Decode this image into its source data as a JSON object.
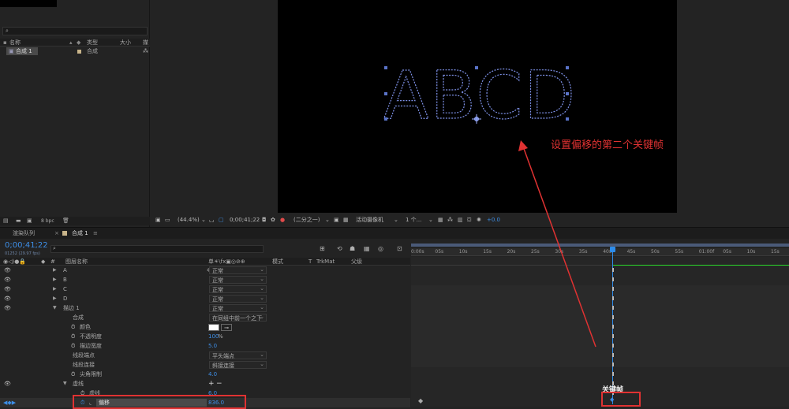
{
  "project": {
    "search_icon": "search-icon",
    "col_name": "名称",
    "col_type": "类型",
    "col_size": "大小",
    "col_extra": "媒",
    "item_name": "合成 1",
    "item_type": "合成",
    "bpc": "8 bpc"
  },
  "viewer": {
    "letters": "ABCD",
    "zoom": "(44.4%)",
    "timecode": "0;00;41;22",
    "resolution": "(二分之一)",
    "camera": "活动摄像机",
    "views": "1 个...",
    "exposure": "+0.0",
    "annotation": "设置偏移的第二个关键帧"
  },
  "timeline": {
    "tab_render": "渲染队列",
    "tab_comp": "合成 1",
    "timecode": "0;00;41;22",
    "frame_info": "01252 (29.97 fps)",
    "col_layer": "图层名称",
    "col_switches": "单☀\\fx▣◎⊘⊕",
    "col_mode": "模式",
    "col_t": "T",
    "col_trkmat": "TrkMat",
    "col_parent": "父级",
    "ticks": [
      "0:00s",
      "05s",
      "10s",
      "15s",
      "20s",
      "25s",
      "30s",
      "35s",
      "40s",
      "45s",
      "50s",
      "55s",
      "01:00f",
      "05s",
      "10s",
      "15s"
    ],
    "layers": [
      {
        "name": "A",
        "mode": "正常"
      },
      {
        "name": "B",
        "mode": "正常"
      },
      {
        "name": "C",
        "mode": "正常"
      },
      {
        "name": "D",
        "mode": "正常"
      },
      {
        "name": "描边 1",
        "mode": "正常"
      }
    ],
    "props": {
      "composite": "合成",
      "composite_val": "在同组中前一个之下",
      "color": "颜色",
      "opacity": "不透明度",
      "opacity_val": "100",
      "opacity_unit": "%",
      "stroke_width": "描边宽度",
      "stroke_width_val": "5.0",
      "line_cap": "线段端点",
      "line_cap_val": "平头端点",
      "line_join": "线段连接",
      "line_join_val": "斜接连接",
      "miter": "尖角限制",
      "miter_val": "4.0",
      "dashes": "虚线",
      "dash": "虚线",
      "dash_val": "6.0",
      "offset": "偏移",
      "offset_val": "836.0",
      "plus": "+",
      "minus": "−"
    },
    "lower_text": "关键帧"
  },
  "colors": {
    "accent_blue": "#2d8ceb",
    "annotation_red": "#e03232",
    "green": "#2bd92b",
    "selection": "#5a73c8"
  }
}
